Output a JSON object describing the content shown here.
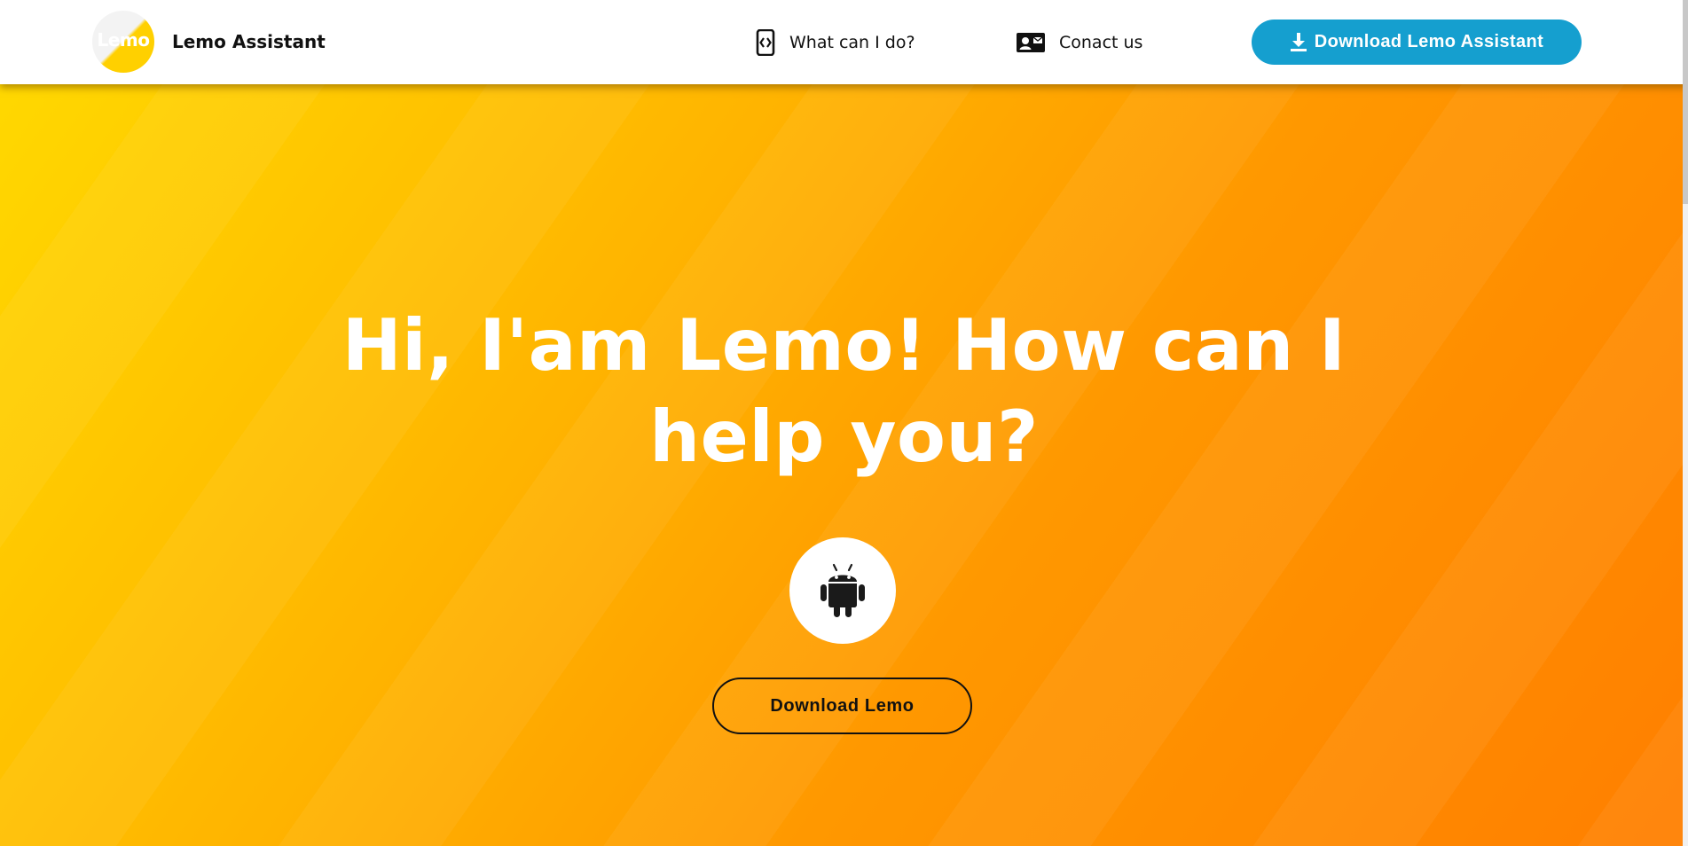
{
  "header": {
    "brand": {
      "logo_text_left": "Le",
      "logo_text_right": "mo",
      "name": "Lemo Assistant"
    },
    "nav": [
      {
        "label": "What can I do?",
        "icon": "phone-code-icon"
      },
      {
        "label": "Conact us",
        "icon": "contact-card-icon"
      }
    ],
    "download_button": {
      "label": "Download Lemo Assistant",
      "icon": "download-icon"
    }
  },
  "hero": {
    "title_line1": "Hi, I'am Lemo! How can I",
    "title_line2": "help you?",
    "platform_icon": "android-icon",
    "cta_label": "Download Lemo"
  },
  "colors": {
    "accent_blue": "#159fcf",
    "gradient_start": "#ffd800",
    "gradient_end": "#ff7f00",
    "text_dark": "#111111",
    "text_light": "#ffffff"
  }
}
